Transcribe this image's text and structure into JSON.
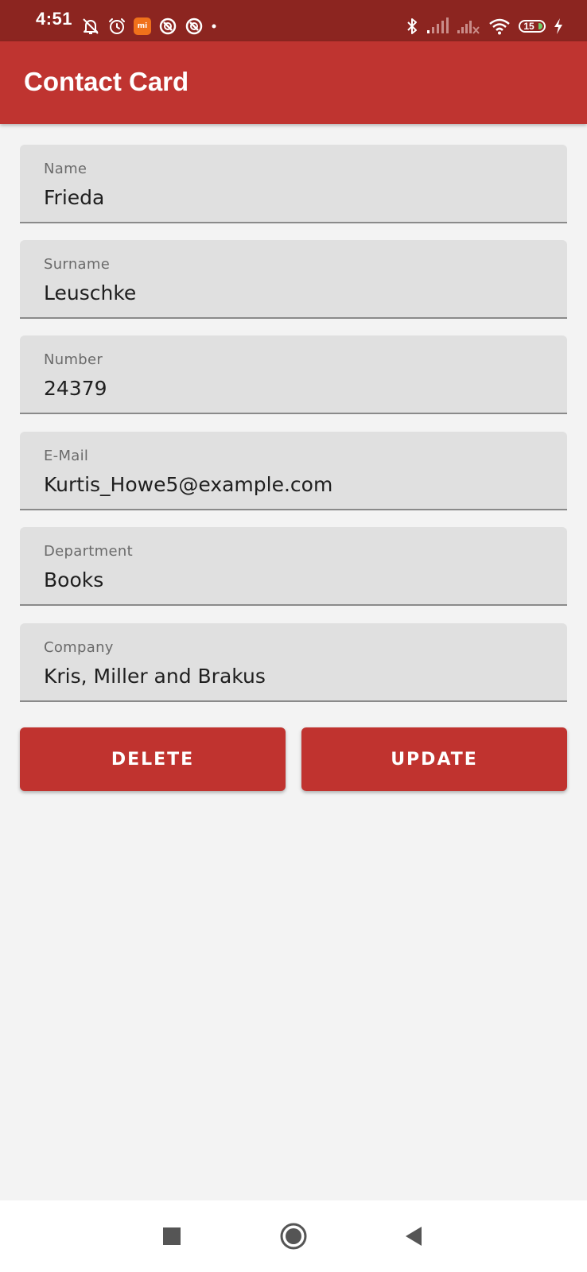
{
  "status_bar": {
    "time": "4:51",
    "battery_level": "15",
    "left_icons": [
      "bell-off-icon",
      "alarm-icon",
      "mi-app-icon",
      "app-notification-icon",
      "app-notification-icon",
      "more-dot-icon"
    ],
    "right_icons": [
      "bluetooth-icon",
      "signal-icon",
      "signal-no-sim-icon",
      "wifi-icon",
      "battery-icon",
      "charging-icon"
    ],
    "mi_badge_text": "mi",
    "bg_color": "#8c2520"
  },
  "app_bar": {
    "title": "Contact Card",
    "bg_color": "#bf3430"
  },
  "form": {
    "fields": [
      {
        "label": "Name",
        "value": "Frieda"
      },
      {
        "label": "Surname",
        "value": "Leuschke"
      },
      {
        "label": "Number",
        "value": "24379"
      },
      {
        "label": "E-Mail",
        "value": "Kurtis_Howe5@example.com"
      },
      {
        "label": "Department",
        "value": "Books"
      },
      {
        "label": "Company",
        "value": "Kris, Miller and Brakus"
      }
    ]
  },
  "actions": {
    "delete_label": "DELETE",
    "update_label": "UPDATE",
    "button_color": "#c0332f"
  },
  "nav_bar": {
    "buttons": [
      "recents-square-icon",
      "home-circle-icon",
      "back-triangle-icon"
    ]
  }
}
